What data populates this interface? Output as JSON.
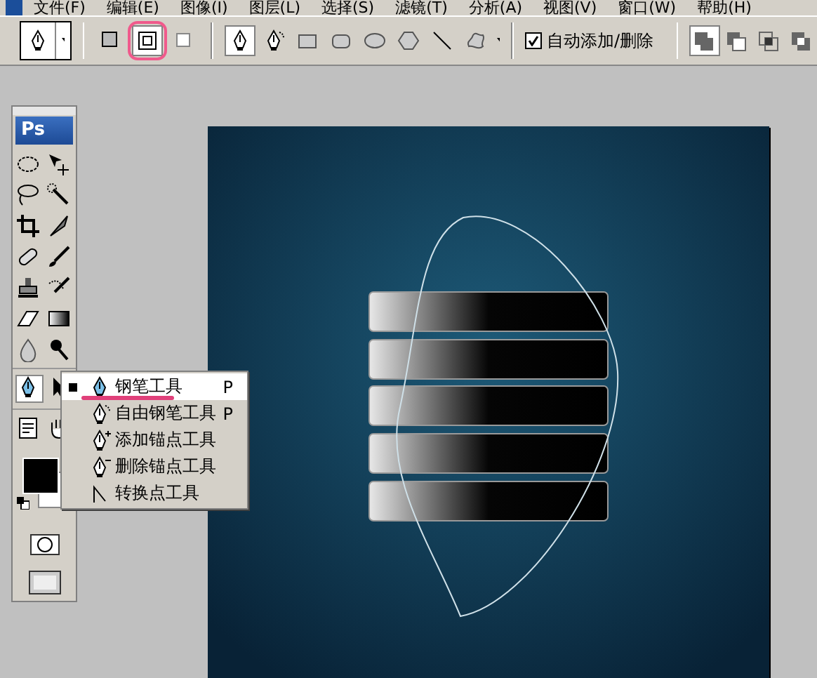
{
  "menubar": {
    "items": [
      {
        "label": "文件(F)"
      },
      {
        "label": "编辑(E)"
      },
      {
        "label": "图像(I)"
      },
      {
        "label": "图层(L)"
      },
      {
        "label": "选择(S)"
      },
      {
        "label": "滤镜(T)"
      },
      {
        "label": "分析(A)"
      },
      {
        "label": "视图(V)"
      },
      {
        "label": "窗口(W)"
      },
      {
        "label": "帮助(H)"
      }
    ]
  },
  "options_bar": {
    "path_modes": [
      {
        "kind": "shape-layers",
        "selected": false,
        "annotated": false
      },
      {
        "kind": "paths",
        "selected": true,
        "annotated": true
      },
      {
        "kind": "fill-pixels",
        "selected": false,
        "annotated": false
      }
    ],
    "draw_tools": [
      {
        "kind": "pen",
        "selected": true
      },
      {
        "kind": "freeform-pen",
        "selected": false
      },
      {
        "kind": "rectangle",
        "selected": false
      },
      {
        "kind": "rounded-rectangle",
        "selected": false
      },
      {
        "kind": "ellipse",
        "selected": false
      },
      {
        "kind": "polygon",
        "selected": false
      },
      {
        "kind": "line",
        "selected": false
      },
      {
        "kind": "custom-shape",
        "selected": false
      }
    ],
    "auto_add_delete": {
      "label": "自动添加/删除",
      "checked": true
    },
    "combine_modes": [
      {
        "kind": "add",
        "selected": true
      },
      {
        "kind": "subtract",
        "selected": false
      },
      {
        "kind": "intersect",
        "selected": false
      },
      {
        "kind": "exclude",
        "selected": false
      }
    ]
  },
  "toolbox": {
    "logo": "Ps"
  },
  "flyout": {
    "items": [
      {
        "kind": "pen",
        "label": "钢笔工具",
        "shortcut": "P",
        "selected": true,
        "annotated": true
      },
      {
        "kind": "freeform-pen",
        "label": "自由钢笔工具",
        "shortcut": "P",
        "selected": false,
        "annotated": false
      },
      {
        "kind": "add-anchor",
        "label": "添加锚点工具",
        "selected": false,
        "annotated": false
      },
      {
        "kind": "delete-anchor",
        "label": "删除锚点工具",
        "selected": false,
        "annotated": false
      },
      {
        "kind": "convert-point",
        "label": "转换点工具",
        "selected": false,
        "annotated": false
      }
    ]
  }
}
